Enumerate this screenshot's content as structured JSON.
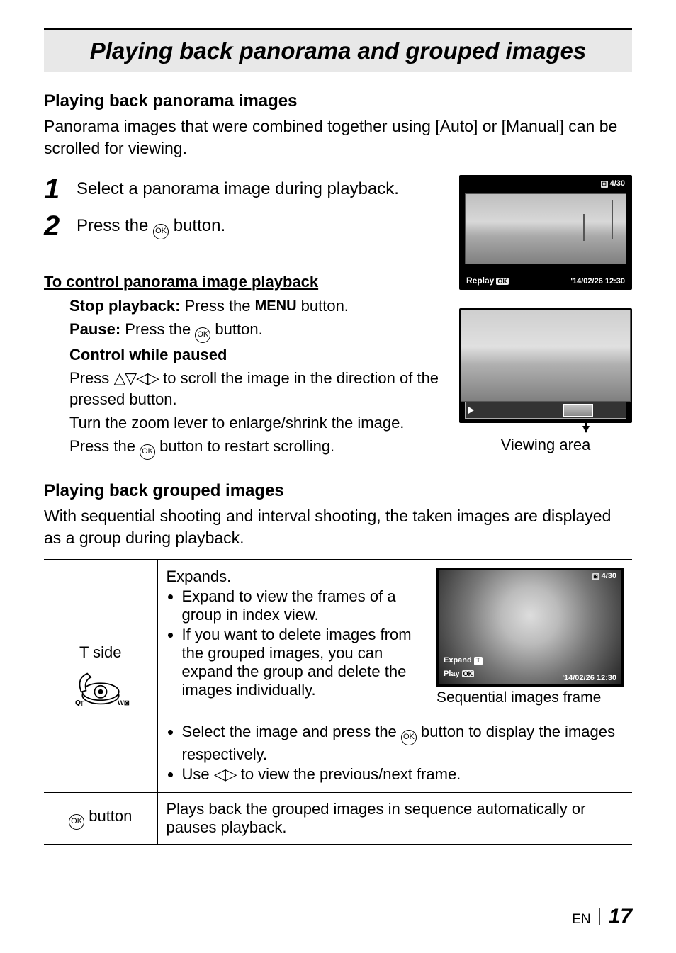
{
  "page": {
    "title": "Playing back panorama and grouped images",
    "footer": {
      "lang": "EN",
      "number": "17"
    }
  },
  "section_panorama": {
    "heading": "Playing back panorama images",
    "intro": "Panorama images that were combined together using [Auto] or [Manual] can be scrolled for viewing.",
    "steps": [
      {
        "text": "Select a panorama image during playback."
      },
      {
        "text_before": "Press the ",
        "text_after": " button."
      }
    ]
  },
  "screen_panorama": {
    "counter": "4/30",
    "replay_label": "Replay",
    "datetime": "'14/02/26  12:30"
  },
  "screen_viewing_area": {
    "caption": "Viewing area"
  },
  "control": {
    "heading": "To control panorama image playback",
    "stop_label": "Stop playback:",
    "stop_text_before": " Press the ",
    "stop_menu": "MENU",
    "stop_text_after": " button.",
    "pause_label": "Pause:",
    "pause_text_before": " Press the ",
    "pause_text_after": " button.",
    "while_paused_label": "Control while paused",
    "line_arrows_before": "Press ",
    "line_arrows_after": " to scroll the image in the direction of the pressed button.",
    "line_zoom": "Turn the zoom lever to enlarge/shrink the image.",
    "line_restart_before": "Press the ",
    "line_restart_after": " button to restart scrolling."
  },
  "section_grouped": {
    "heading": "Playing back grouped images",
    "intro": "With sequential shooting and interval shooting, the taken images are displayed as a group during playback."
  },
  "table": {
    "row1": {
      "left_label": "T side",
      "expands": "Expands.",
      "bullet1": "Expand to view the frames of a group in index view.",
      "bullet2": "If you want to delete images from the grouped images, you can expand the group and delete the images individually.",
      "bullet3_before": "Select the image and press the ",
      "bullet3_after": " button to display the images respectively.",
      "bullet4_before": "Use ",
      "bullet4_after": " to view the previous/next frame."
    },
    "row2": {
      "left_after": " button",
      "text": "Plays back the grouped images in sequence automatically or pauses playback."
    },
    "seq_screen": {
      "counter": "4/30",
      "expand": "Expand",
      "play": "Play",
      "datetime": "'14/02/26  12:30",
      "caption": "Sequential images frame"
    }
  }
}
